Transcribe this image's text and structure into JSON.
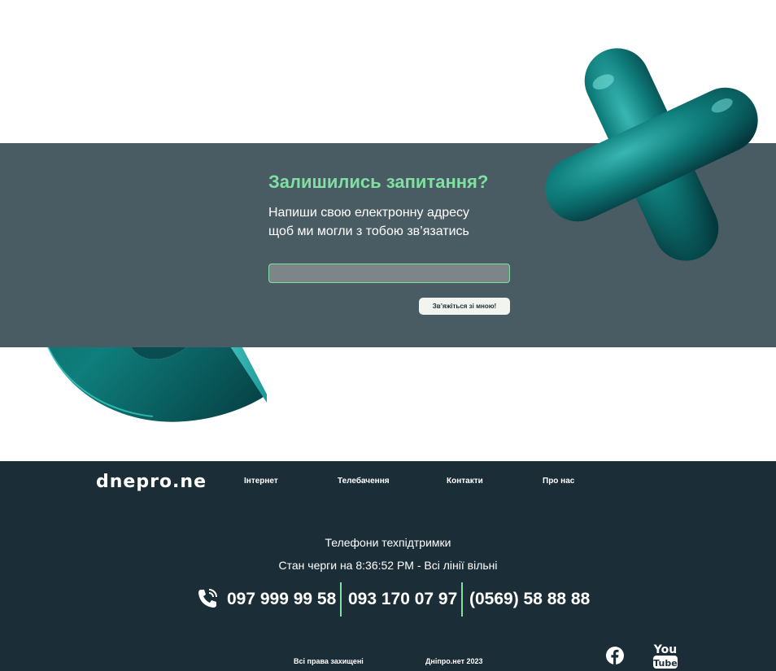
{
  "contact": {
    "title": "Залишились запитання?",
    "subtitle_line1": "Напиши свою електронну адресу",
    "subtitle_line2": "щоб ми могли з тобою зв’язатись",
    "email_value": "",
    "submit_label": "Зв’яжіться зі мною!"
  },
  "footer": {
    "logo_text": "dnepro.net",
    "nav": [
      {
        "label": "Інтернет"
      },
      {
        "label": "Телебачення"
      },
      {
        "label": "Контакти"
      },
      {
        "label": "Про нас"
      }
    ],
    "support_title": "Телефони техпідтримки",
    "queue_status": "Стан черги на 8:36:52 PM - Всі лінії вільні",
    "phones": [
      "097 999 99 58",
      "093 170 07 97",
      "(0569) 58 88 88"
    ],
    "rights": "Всі права захищені",
    "copyright": "Дніпро.нет 2023",
    "youtube_you": "You",
    "youtube_tube": "Tube"
  },
  "colors": {
    "accent": "#7fe0a2",
    "band": "#4a5c63",
    "footer_bg": "#1b2e38",
    "teal": "#0f7e7c"
  },
  "icons": [
    "phone-icon",
    "facebook-icon",
    "youtube-icon"
  ]
}
